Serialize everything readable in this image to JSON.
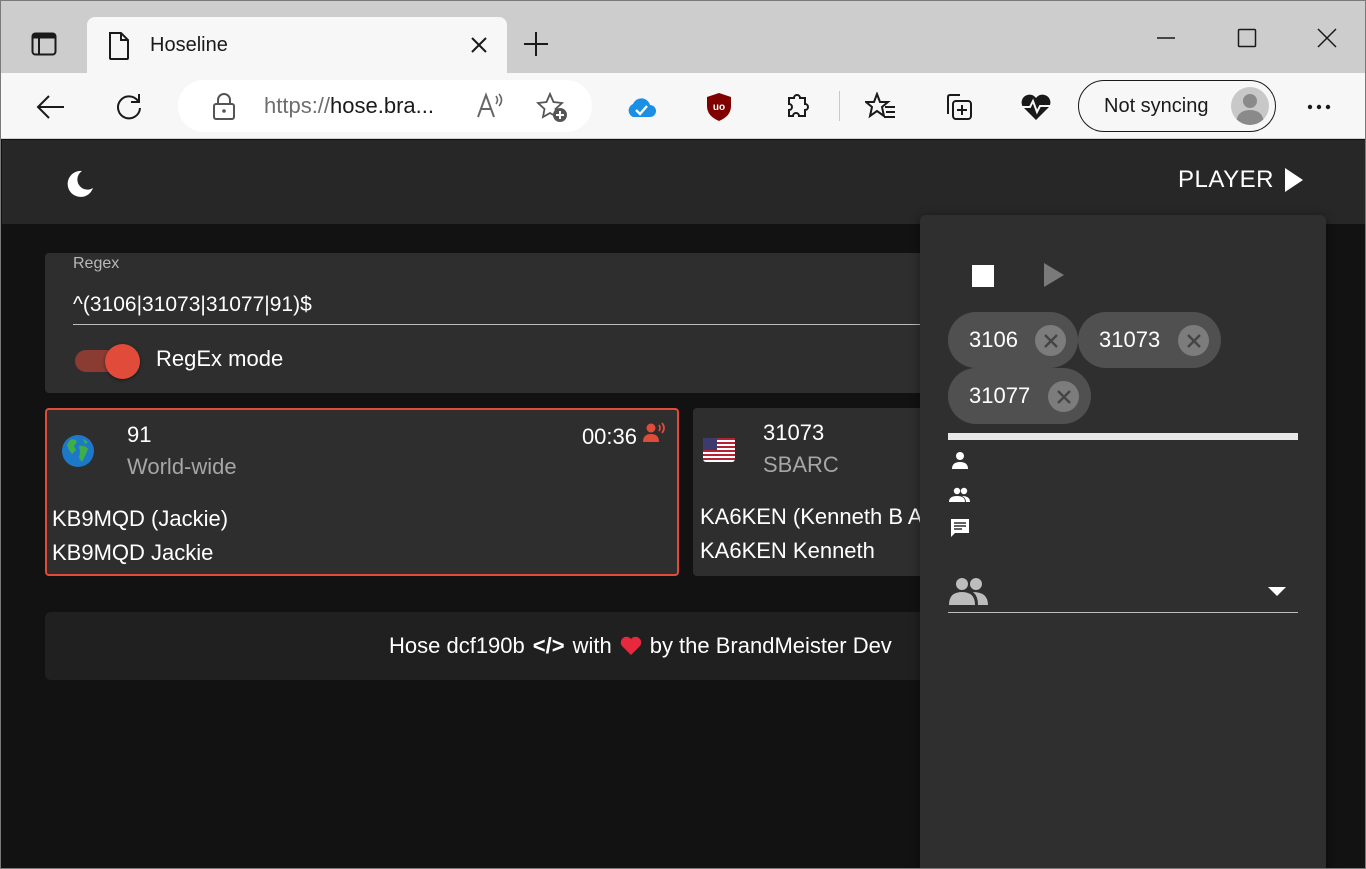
{
  "browser": {
    "tab": {
      "title": "Hoseline"
    },
    "address": {
      "scheme": "https://",
      "host": "hose.bra..."
    },
    "sync": {
      "label": "Not syncing"
    },
    "icons": {
      "tab_actions": "tab-actions-icon",
      "new_tab": "plus-icon",
      "minimize": "minimize-icon",
      "maximize": "maximize-icon",
      "close": "close-icon",
      "back": "back-arrow-icon",
      "refresh": "refresh-icon",
      "lock": "lock-icon",
      "read_aloud": "read-aloud-icon",
      "add_favorite": "star-add-icon",
      "onedrive": "cloud-check-icon",
      "ublock": "ublock-shield-icon",
      "extensions": "puzzle-icon",
      "favorites": "favorites-list-icon",
      "collections": "collections-icon",
      "health": "heart-pulse-icon",
      "more": "more-dots-icon"
    }
  },
  "app": {
    "header": {
      "player_label": "PLAYER"
    },
    "filter": {
      "label": "Regex",
      "value": "^(3106|31073|31077|91)$",
      "switch_label": "RegEx mode",
      "switch_on": true
    },
    "talkgroups": [
      {
        "id": "91",
        "name": "World-wide",
        "flag": "globe",
        "duration": "00:36",
        "active": true,
        "talker_line1": "KB9MQD (Jackie)",
        "talker_line2": "KB9MQD Jackie"
      },
      {
        "id": "31073",
        "name": "SBARC",
        "flag": "us-flag",
        "duration": "",
        "active": false,
        "talker_line1": "KA6KEN (Kenneth B A",
        "talker_line2": "KA6KEN Kenneth"
      }
    ],
    "footer": {
      "prefix": "Hose dcf190b",
      "code_symbol": "</>",
      "with": "with",
      "heart": "❤️",
      "suffix": "by the BrandMeister Dev"
    },
    "player": {
      "chips": [
        {
          "label": "3106"
        },
        {
          "label": "31073"
        },
        {
          "label": "31077"
        }
      ],
      "progress_percent": 100,
      "select_icon": "group-icon",
      "colors": {
        "accent": "#e14c3a",
        "panel": "#2f2f2f"
      }
    }
  }
}
